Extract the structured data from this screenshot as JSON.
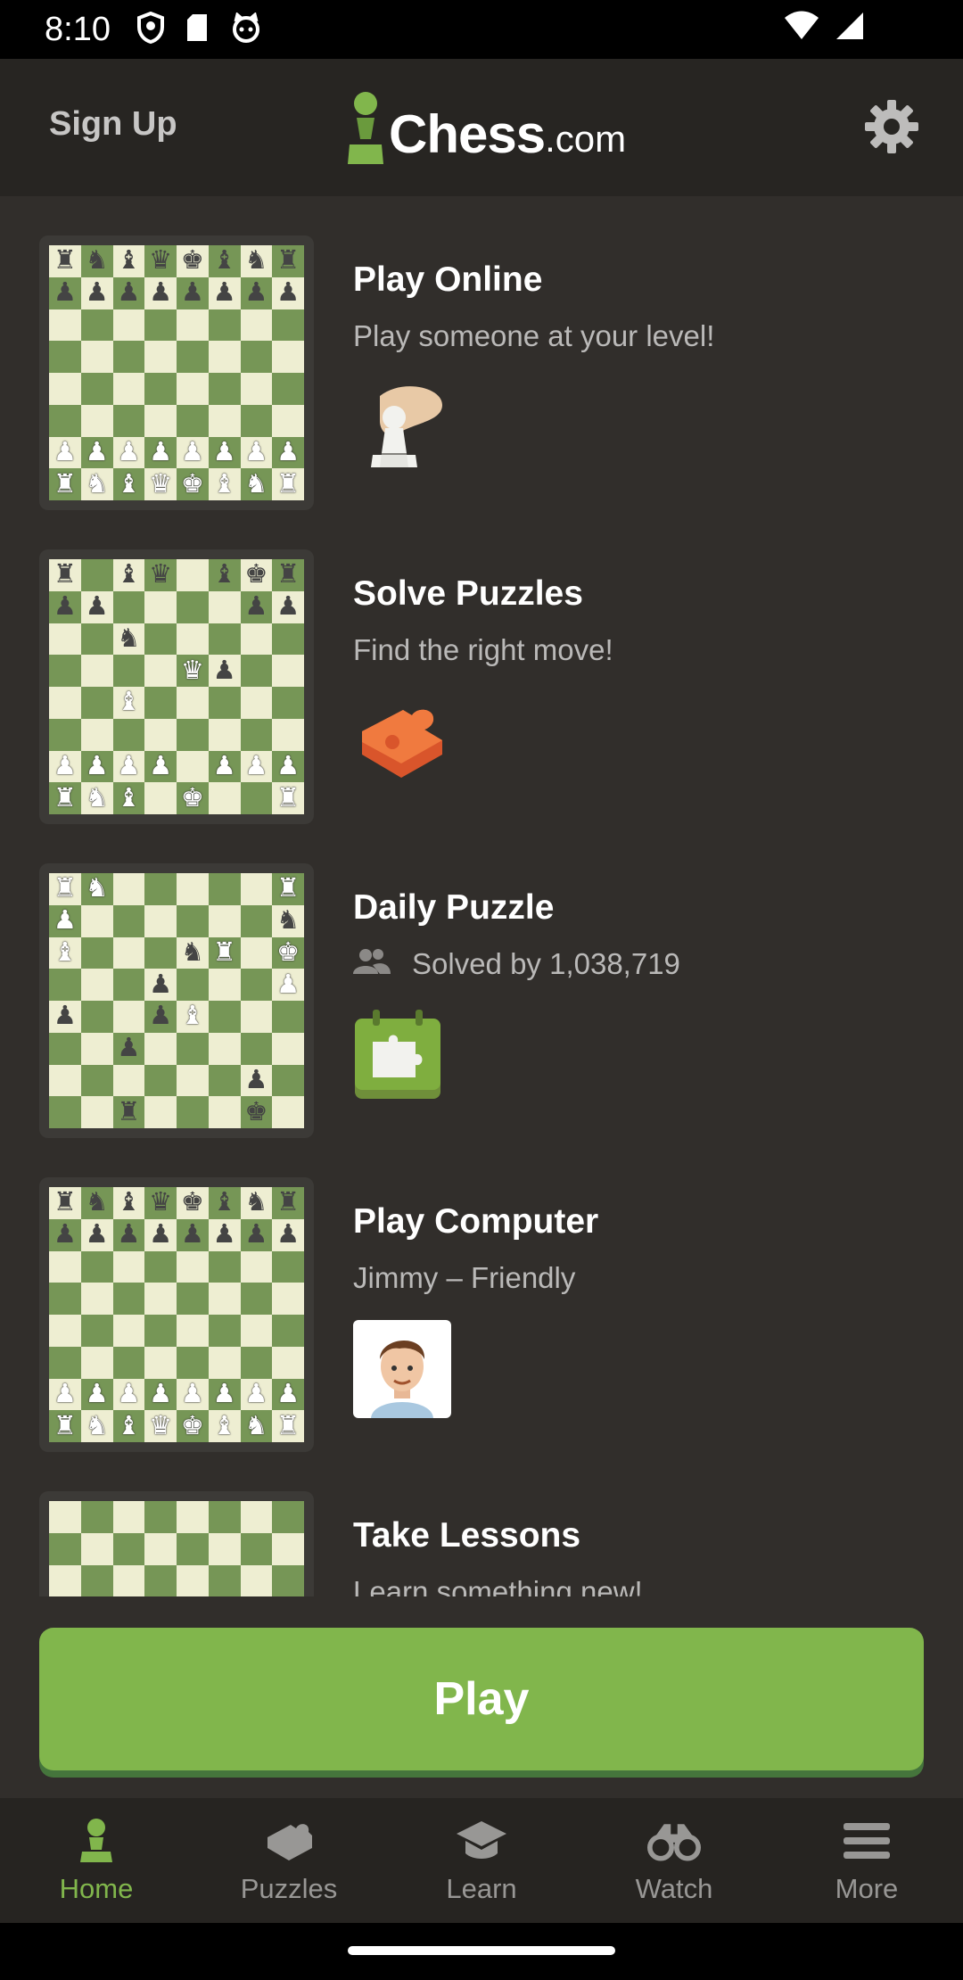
{
  "status_bar": {
    "time": "8:10"
  },
  "header": {
    "signup_label": "Sign Up",
    "logo_main": "Chess",
    "logo_suffix": ".com"
  },
  "cards": [
    {
      "title": "Play Online",
      "subtitle": "Play someone at your level!",
      "icon": "hand-pawn-icon",
      "board": [
        "rnbqkbnr",
        "pppppppp",
        "........",
        "........",
        "........",
        "........",
        "PPPPPPPP",
        "RNBQKBNR"
      ]
    },
    {
      "title": "Solve Puzzles",
      "subtitle": "Find the right move!",
      "icon": "puzzle-piece-icon",
      "board": [
        "r.bq.bkr",
        "pp....pp",
        "..n.....",
        "....Qp..",
        "..B.....",
        "........",
        "PPPP.PPP",
        "RNB.K..R"
      ]
    },
    {
      "title": "Daily Puzzle",
      "subtitle": "Solved by 1,038,719",
      "icon": "calendar-puzzle-icon",
      "board": [
        "RN.....R",
        "P......n",
        "B...nR.K",
        "...p...P",
        "p..pB...",
        "..p.....",
        "......p.",
        "..r...k."
      ]
    },
    {
      "title": "Play Computer",
      "subtitle": "Jimmy – Friendly",
      "icon": "bot-avatar-icon",
      "board": [
        "rnbqkbnr",
        "pppppppp",
        "........",
        "........",
        "........",
        "........",
        "PPPPPPPP",
        "RNBQKBNR"
      ]
    },
    {
      "title": "Take Lessons",
      "subtitle": "Learn something new!",
      "icon": "lesson-icon",
      "board": [
        "........",
        "........",
        "........",
        "........",
        "........",
        "........",
        "........",
        "........"
      ]
    }
  ],
  "play_button": {
    "label": "Play"
  },
  "nav": [
    {
      "label": "Home",
      "icon": "home-pawn-icon",
      "active": true
    },
    {
      "label": "Puzzles",
      "icon": "puzzle-icon",
      "active": false
    },
    {
      "label": "Learn",
      "icon": "graduation-cap-icon",
      "active": false
    },
    {
      "label": "Watch",
      "icon": "binoculars-icon",
      "active": false
    },
    {
      "label": "More",
      "icon": "menu-icon",
      "active": false
    }
  ],
  "colors": {
    "accent": "#81b64c",
    "background": "#312e2b",
    "header": "#272522",
    "board_light": "#eeeed2",
    "board_dark": "#769656"
  }
}
